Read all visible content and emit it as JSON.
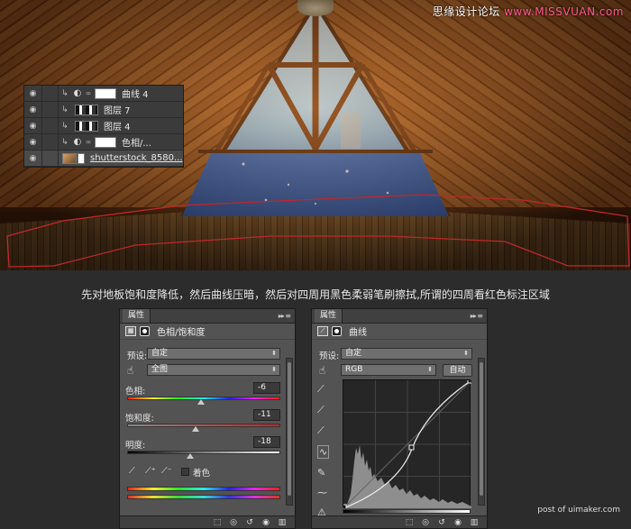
{
  "watermark": {
    "prefix": "思缘设计论坛 ",
    "site": "www.MISSVUAN.com"
  },
  "layers_panel": {
    "rows": [
      {
        "name": "曲线 4",
        "kind": "adjustment"
      },
      {
        "name": "图层 7",
        "kind": "pixel"
      },
      {
        "name": "图层 4",
        "kind": "pixel"
      },
      {
        "name": "色相/...",
        "kind": "adjustment"
      },
      {
        "name": "shutterstock_8580...",
        "kind": "photo"
      }
    ]
  },
  "caption": "先对地板饱和度降低，然后曲线压暗，然后对四周用黑色柔弱笔刷擦拭,所谓的四周看红色标注区域",
  "hue_panel": {
    "tab": "属性",
    "tab_menu": "▸▸ ≡",
    "title": "色相/饱和度",
    "preset_label": "预设:",
    "preset_value": "自定",
    "channel_value": "全图",
    "hue_label": "色相:",
    "hue_value": "-6",
    "saturation_label": "饱和度:",
    "saturation_value": "-11",
    "lightness_label": "明度:",
    "lightness_value": "-18",
    "colorize_label": "着色",
    "hue_knob": -0.033,
    "sat_knob": -0.11,
    "light_knob": -0.18
  },
  "curves_panel": {
    "tab": "属性",
    "tab_menu": "▸▸ ≡",
    "title": "曲线",
    "preset_label": "预设:",
    "preset_value": "自定",
    "channel_value": "RGB",
    "auto_label": "自动"
  },
  "footer": "post of uimaker.com",
  "colors": {
    "accent_red": "#c0282a",
    "panel_bg": "#535353",
    "page_bg": "#2c2c2c"
  }
}
